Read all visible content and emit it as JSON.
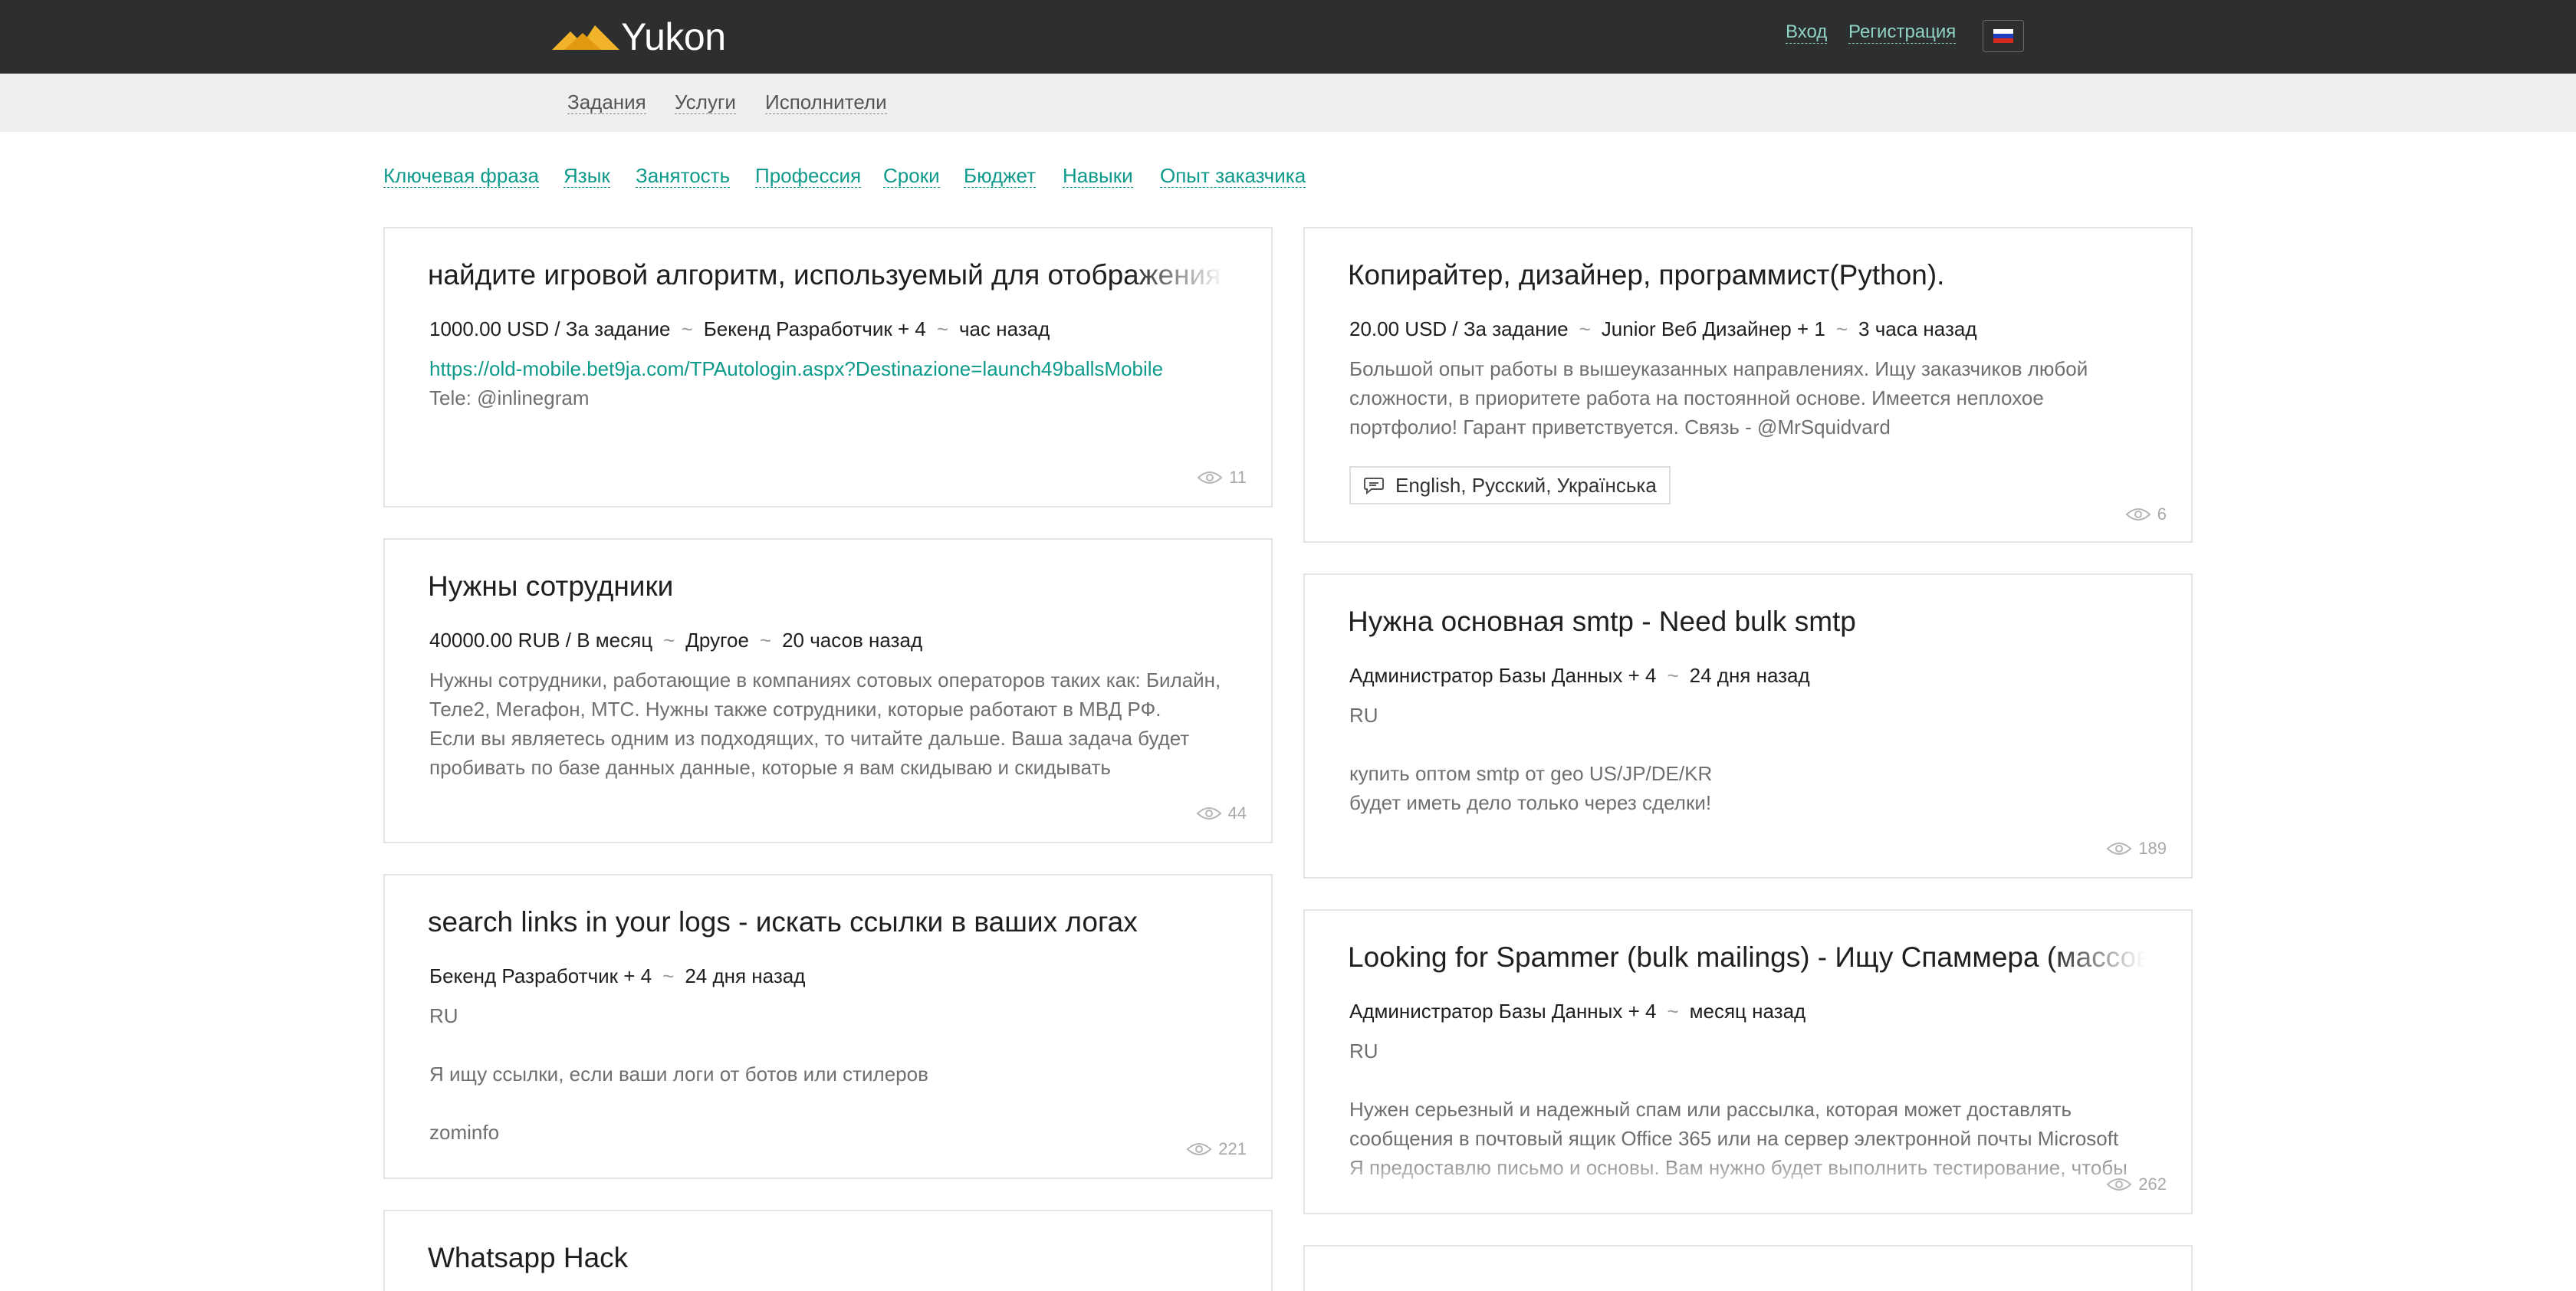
{
  "header": {
    "brand": "Yukon",
    "login": "Вход",
    "register": "Регистрация",
    "flag_colors": [
      "#ffffff",
      "#1c3fbf",
      "#d52b1e"
    ]
  },
  "subnav": {
    "items": [
      "Задания",
      "Услуги",
      "Исполнители"
    ]
  },
  "filters": [
    "Ключевая фраза",
    "Язык",
    "Занятость",
    "Профессия",
    "Сроки",
    "Бюджет",
    "Навыки",
    "Опыт заказчика"
  ],
  "cards": [
    {
      "title": "найдите игровой алгоритм, используемый для отображения",
      "price": "1000.00 USD / За задание",
      "role": "Бекенд Разработчик + 4",
      "time": "час назад",
      "link": "https://old-mobile.bet9ja.com/TPAutologin.aspx?Destinazione=launch49ballsMobile",
      "body": "\nTele: @inlinegram",
      "views": "11"
    },
    {
      "title": "Копирайтер, дизайнер, программист(Python).",
      "price": "20.00 USD / За задание",
      "role": "Junior Веб Дизайнер + 1",
      "time": "3 часа назад",
      "body": "Большой опыт работы в вышеуказанных направлениях. Ищу заказчиков любой сложности, в приоритете работа на постоянной основе. Имеется неплохое портфолио! Гарант приветствуется. Связь - @MrSquidvard",
      "languages": "English, Русский, Українська",
      "views": "6"
    },
    {
      "title": "Нужны сотрудники",
      "price": "40000.00 RUB / В месяц",
      "role": "Другое",
      "time": "20 часов назад",
      "body": "Нужны сотрудники, работающие в компаниях сотовых операторов таких как: Билайн, Теле2, Мегафон, МТС. Нужны также сотрудники, которые работают в МВД РФ.\nЕсли вы являетесь одним из подходящих, то читайте дальше. Ваша задача будет пробивать по базе данных данные, которые я вам скидываю и скидывать",
      "views": "44"
    },
    {
      "title": "Нужна основная smtp - Need bulk smtp",
      "role": "Администратор Базы Данных + 4",
      "time": "24 дня назад",
      "body": "RU\n\nкупить оптом smtp от geo US/JP/DE/KR\nбудет иметь дело только через сделки!",
      "views": "189"
    },
    {
      "title": "search links in your logs - искать ссылки в ваших логах",
      "role": "Бекенд Разработчик + 4",
      "time": "24 дня назад",
      "body": "RU\n\nЯ ищу ссылки, если ваши логи от ботов или стилеров\n\nzominfo",
      "views": "221"
    },
    {
      "title": "Looking for Spammer (bulk mailings) - Ищу Спаммера (массовые рассылки)",
      "role": "Администратор Базы Данных + 4",
      "time": "месяц назад",
      "body": "RU\n\nНужен серьезный и надежный спам или рассылка, которая может доставлять сообщения в почтовый ящик Office 365 или на сервер электронной почты Microsoft\nЯ предоставлю письмо и основы. Вам нужно будет выполнить тестирование, чтобы",
      "views": "262"
    },
    {
      "title": "Whatsapp Hack"
    }
  ]
}
